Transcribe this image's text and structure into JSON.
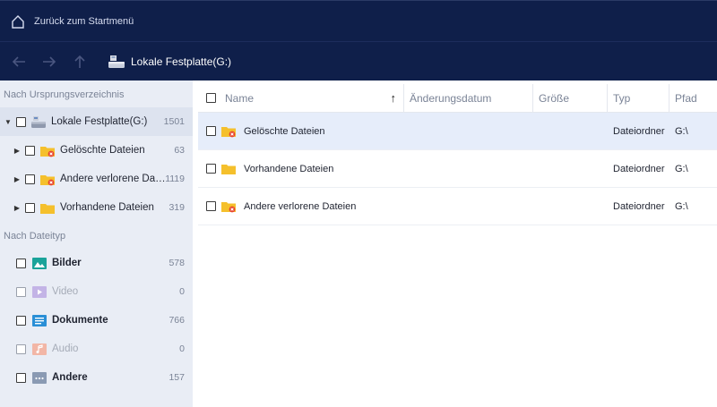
{
  "header": {
    "back_label": "Zurück zum Startmenü"
  },
  "nav": {
    "path": "Lokale Festplatte(G:)"
  },
  "sidebar": {
    "origin_section": "Nach Ursprungsverzeichnis",
    "root": {
      "label": "Lokale Festplatte(G:)",
      "count": "1501"
    },
    "folders": [
      {
        "label": "Gelöschte Dateien",
        "count": "63"
      },
      {
        "label": "Andere verlorene Dat…",
        "count": "1119"
      },
      {
        "label": "Vorhandene Dateien",
        "count": "319"
      }
    ],
    "type_section": "Nach Dateityp",
    "types": [
      {
        "label": "Bilder",
        "count": "578"
      },
      {
        "label": "Video",
        "count": "0"
      },
      {
        "label": "Dokumente",
        "count": "766"
      },
      {
        "label": "Audio",
        "count": "0"
      },
      {
        "label": "Andere",
        "count": "157"
      }
    ]
  },
  "table": {
    "columns": {
      "name": "Name",
      "sort_indicator": "↑",
      "modified": "Änderungsdatum",
      "size": "Größe",
      "type": "Typ",
      "path": "Pfad"
    },
    "rows": [
      {
        "name": "Gelöschte Dateien",
        "modified": "",
        "size": "",
        "type": "Dateiordner",
        "path": "G:\\"
      },
      {
        "name": "Vorhandene Dateien",
        "modified": "",
        "size": "",
        "type": "Dateiordner",
        "path": "G:\\"
      },
      {
        "name": "Andere verlorene Dateien",
        "modified": "",
        "size": "",
        "type": "Dateiordner",
        "path": "G:\\"
      }
    ]
  },
  "colors": {
    "header_bg": "#0f1f4a",
    "sidebar_bg": "#e9edf5",
    "selected_row": "#e6edfa",
    "folder": "#f5c02c",
    "deleted_badge": "#e8432e"
  }
}
